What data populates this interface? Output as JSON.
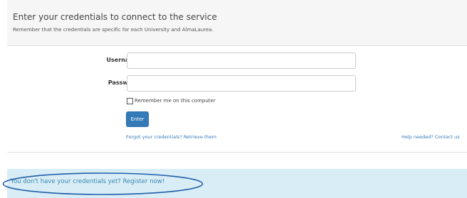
{
  "header": {
    "title": "Enter your credentials to connect to the service",
    "subtitle": "Remember that the credentials are specific for each University and AlmaLaurea."
  },
  "form": {
    "username_label": "Username",
    "username_value": "",
    "password_label": "Password",
    "password_value": "",
    "remember_label": "Remember me on this computer",
    "remember_checked": false,
    "enter_label": "Enter",
    "forgot_link": "Forgot your credentials? Retrieve them",
    "help_link": "Help needed? Contact us"
  },
  "register": {
    "text": "You don't have your credentials yet? Register now!"
  },
  "colors": {
    "primary": "#337ab7",
    "banner_bg": "#d9edf7",
    "banner_text": "#3a87ad",
    "highlight": "#1f5fa8"
  }
}
